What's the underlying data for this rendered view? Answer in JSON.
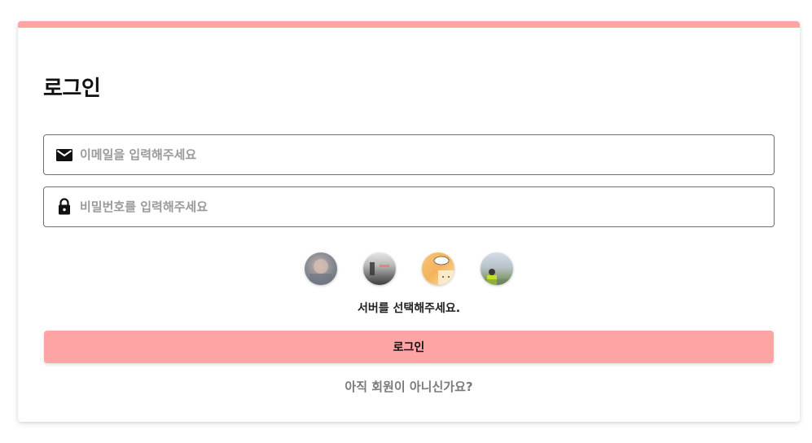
{
  "page": {
    "title": "로그인",
    "accent_color": "#ffa4a4"
  },
  "form": {
    "email": {
      "icon": "mail-icon",
      "placeholder": "이메일을 입력해주세요",
      "value": ""
    },
    "password": {
      "icon": "lock-icon",
      "placeholder": "비밀번호를 입력해주세요",
      "value": ""
    }
  },
  "servers": {
    "items": [
      {
        "name": "server-1"
      },
      {
        "name": "server-2"
      },
      {
        "name": "server-3"
      },
      {
        "name": "server-4"
      }
    ],
    "hint": "서버를 선택해주세요."
  },
  "actions": {
    "login_label": "로그인",
    "signup_label": "아직 회원이 아니신가요?"
  }
}
